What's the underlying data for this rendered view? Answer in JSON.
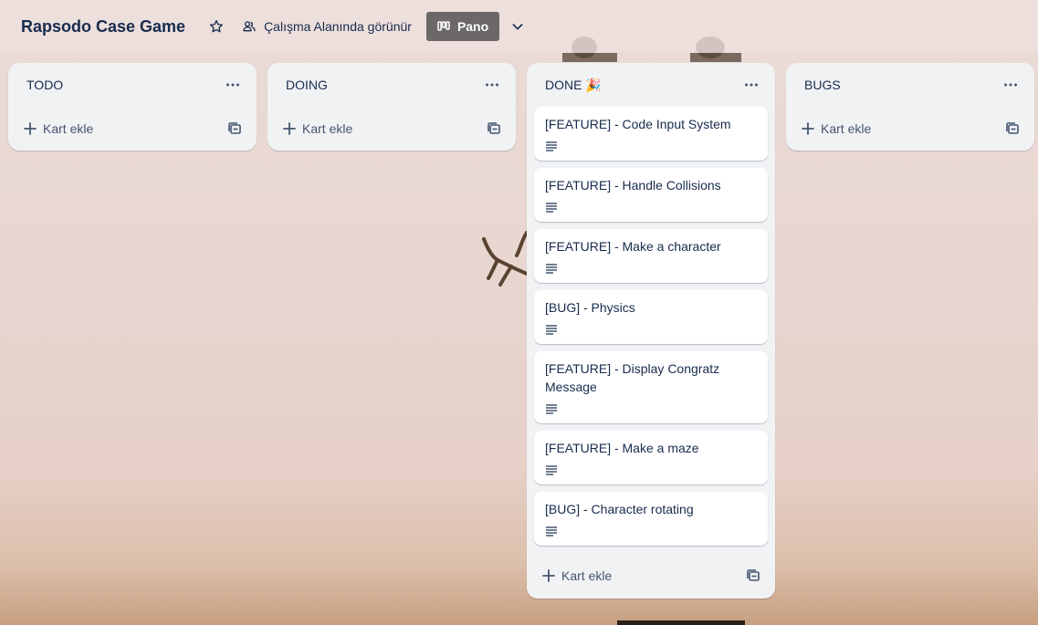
{
  "board": {
    "title": "Rapsodo Case Game",
    "star_icon": "star-icon",
    "visibility_label": "Çalışma Alanında görünür",
    "visibility_icon": "people-icon",
    "view_label": "Pano",
    "view_icon": "board-view-icon",
    "view_chevron_icon": "chevron-down-icon"
  },
  "lists": [
    {
      "title": "TODO",
      "add_label": "Kart ekle",
      "cards": []
    },
    {
      "title": "DOING",
      "add_label": "Kart ekle",
      "cards": []
    },
    {
      "title": "DONE",
      "emoji": "🎉",
      "add_label": "Kart ekle",
      "cards": [
        {
          "title": "[FEATURE] - Code Input System",
          "has_description": true
        },
        {
          "title": "[FEATURE] - Handle Collisions",
          "has_description": true
        },
        {
          "title": "[FEATURE] - Make a character",
          "has_description": true
        },
        {
          "title": "[BUG] - Physics",
          "has_description": true
        },
        {
          "title": "[FEATURE] - Display Congratz Message",
          "has_description": true
        },
        {
          "title": "[FEATURE] - Make a maze",
          "has_description": true
        },
        {
          "title": "[BUG] - Character rotating",
          "has_description": true
        }
      ]
    },
    {
      "title": "BUGS",
      "add_label": "Kart ekle",
      "cards": []
    }
  ],
  "colors": {
    "header_button_active": "#6b6867",
    "list_bg": "#f1f2f4",
    "text": "#172b4d"
  }
}
